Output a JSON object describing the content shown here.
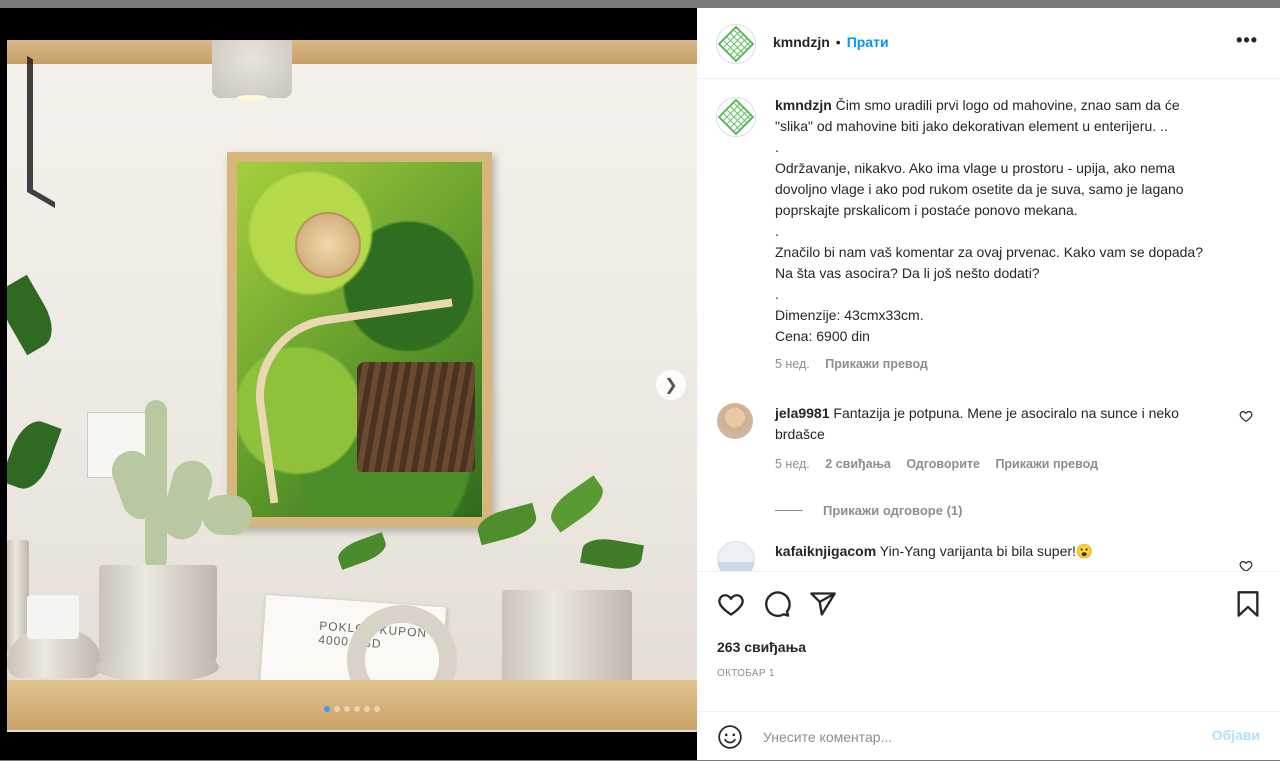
{
  "post": {
    "username": "kmndzjn",
    "separator": "•",
    "follow_label": "Прати",
    "more_label": "•••"
  },
  "caption": {
    "username": "kmndzjn",
    "paragraphs": [
      "Čim smo uradili prvi logo od mahovine, znao sam da će \"slika\" od mahovine biti jako dekorativan element u enterijeru. ..",
      ".",
      "Održavanje, nikakvo. Ako ima vlage u prostoru - upija, ako nema dovoljno vlage i ako pod rukom osetite da je suva, samo je lagano poprskajte prskalicom i postaće ponovo mekana.",
      ".",
      "Značilo bi nam vaš komentar za ovaj prvenac. Kako vam se dopada? Na šta vas asocira? Da li još nešto dodati?",
      ".",
      "Dimenzije: 43cmx33cm.",
      "Cena: 6900 din"
    ],
    "age": "5 нед.",
    "translate_label": "Прикажи превод"
  },
  "comments": [
    {
      "username": "jela9981",
      "text": "Fantazija je potpuna. Mene je asociralo na sunce i neko brdašce",
      "age": "5 нед.",
      "likes": "2 свиђања",
      "reply_label": "Одговорите",
      "translate_label": "Прикажи превод",
      "replies_label": "Прикажи одговоре (1)"
    },
    {
      "username": "kafaiknjigacom",
      "text": "Yin-Yang varijanta bi bila super!😮"
    }
  ],
  "actions": {
    "likes_count": "263 свиђања",
    "date": "ОКТОБАР 1"
  },
  "composer": {
    "placeholder": "Унесите коментар...",
    "post_label": "Објави"
  },
  "media": {
    "card_text": "POKLON KUPON 4000 RSD",
    "slide_count": 6,
    "active_slide": 1
  },
  "colors": {
    "accent": "#0095f6",
    "post_disabled": "#b2dffc",
    "text": "#262626",
    "muted": "#8e8e8e",
    "logo_green": "#5cb85c"
  }
}
